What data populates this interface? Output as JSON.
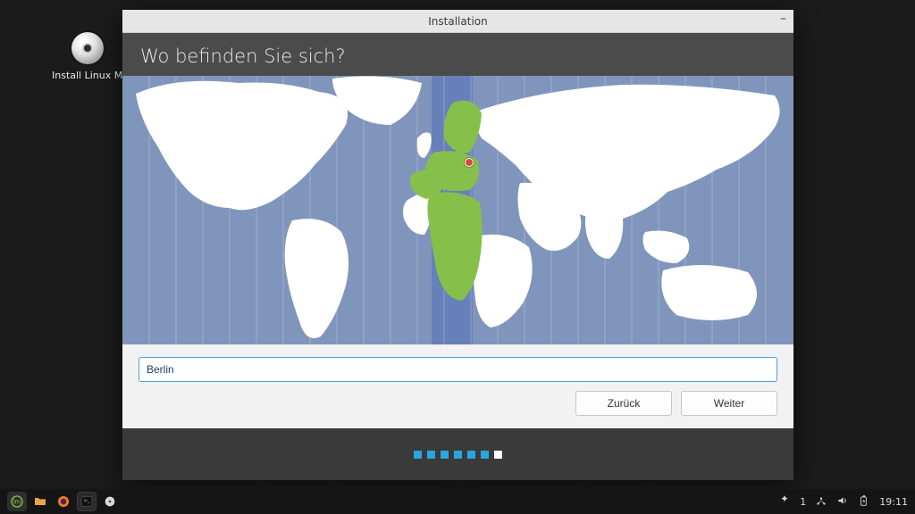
{
  "desktop": {
    "install_icon_label": "Install Linux Min"
  },
  "window": {
    "title": "Installation",
    "heading": "Wo befinden Sie sich?",
    "location_value": "Berlin",
    "buttons": {
      "back": "Zurück",
      "next": "Weiter"
    },
    "progress": {
      "total": 7,
      "current": 6
    },
    "map": {
      "selected_timezone_band_index": 12,
      "pin_city": "Berlin"
    }
  },
  "taskbar": {
    "notifications": "1",
    "clock": "19:11"
  }
}
